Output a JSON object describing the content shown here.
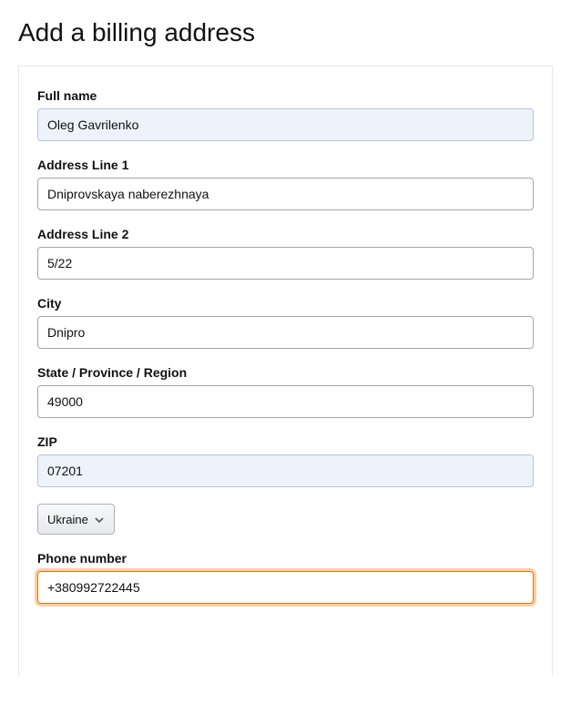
{
  "page": {
    "title": "Add a billing address"
  },
  "form": {
    "fullName": {
      "label": "Full name",
      "value": "Oleg Gavrilenko"
    },
    "address1": {
      "label": "Address Line 1",
      "value": "Dniprovskaya naberezhnaya"
    },
    "address2": {
      "label": "Address Line 2",
      "value": "5/22"
    },
    "city": {
      "label": "City",
      "value": "Dnipro"
    },
    "state": {
      "label": "State / Province / Region",
      "value": "49000"
    },
    "zip": {
      "label": "ZIP",
      "value": "07201"
    },
    "country": {
      "selected": "Ukraine"
    },
    "phone": {
      "label": "Phone number",
      "value": "+380992722445"
    }
  }
}
